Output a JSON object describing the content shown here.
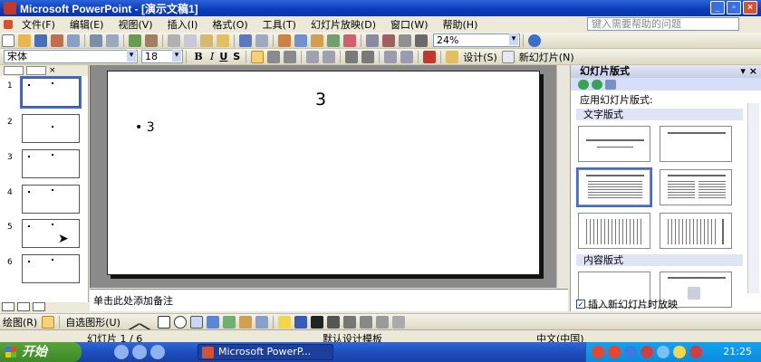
{
  "window": {
    "title": "Microsoft PowerPoint - [演示文稿1]"
  },
  "menu": {
    "items": [
      "文件(F)",
      "编辑(E)",
      "视图(V)",
      "插入(I)",
      "格式(O)",
      "工具(T)",
      "幻灯片放映(D)",
      "窗口(W)",
      "帮助(H)"
    ],
    "help_placeholder": "键入需要帮助的问题"
  },
  "toolbar": {
    "zoom": "24%",
    "design_label": "设计(S)",
    "new_slide_label": "新幻灯片(N)"
  },
  "format_bar": {
    "font": "宋体",
    "size": "18",
    "bold": "B",
    "italic": "I",
    "underline": "U",
    "shadow": "S"
  },
  "outline": {
    "slides": [
      {
        "num": "1",
        "selected": true
      },
      {
        "num": "2",
        "selected": false
      },
      {
        "num": "3",
        "selected": false
      },
      {
        "num": "4",
        "selected": false
      },
      {
        "num": "5",
        "selected": false
      },
      {
        "num": "6",
        "selected": false
      }
    ]
  },
  "slide": {
    "title": "3",
    "bullet": "3"
  },
  "notes": {
    "placeholder": "单击此处添加备注"
  },
  "taskpane": {
    "title": "幻灯片版式",
    "apply_label": "应用幻灯片版式:",
    "section_text": "文字版式",
    "section_content": "内容版式",
    "checkbox_label": "插入新幻灯片时放映",
    "checkbox_checked": true
  },
  "drawbar": {
    "draw_label": "绘图(R)",
    "autoshapes_label": "自选图形(U)"
  },
  "status": {
    "slide": "幻灯片 1 / 6",
    "template": "默认设计模板",
    "language": "中文(中国)"
  },
  "taskbar": {
    "start": "开始",
    "item": "Microsoft PowerP...",
    "clock": "21:25"
  }
}
